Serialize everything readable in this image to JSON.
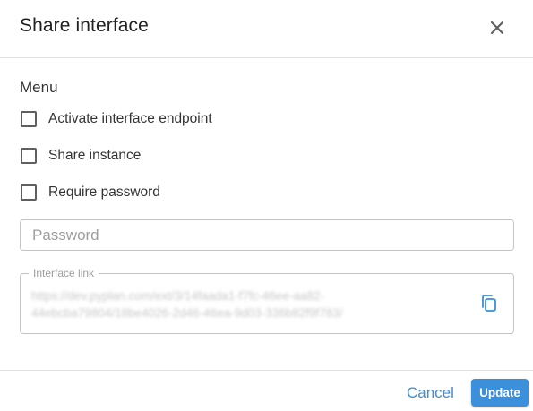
{
  "dialog": {
    "title": "Share interface",
    "close_icon": "close-icon"
  },
  "menu": {
    "label": "Menu",
    "options": [
      {
        "label": "Activate interface endpoint",
        "checked": false
      },
      {
        "label": "Share instance",
        "checked": false
      },
      {
        "label": "Require password",
        "checked": false
      }
    ]
  },
  "password": {
    "placeholder": "Password",
    "value": ""
  },
  "interface_link": {
    "label": "Interface link",
    "line1": "https://dev.pyplan.com/ext/3/14faada1-f7fc-46ee-aa82-",
    "line2": "44ebcba79804/18be4026-2d46-46ea-9d03-336b82f9f783/",
    "copy_icon": "copy-icon"
  },
  "footer": {
    "cancel_label": "Cancel",
    "update_label": "Update"
  },
  "colors": {
    "accent": "#3c8fdb",
    "link_text": "#3f8dd6",
    "border": "#c4c4c4",
    "divider": "#e0e0e0"
  }
}
